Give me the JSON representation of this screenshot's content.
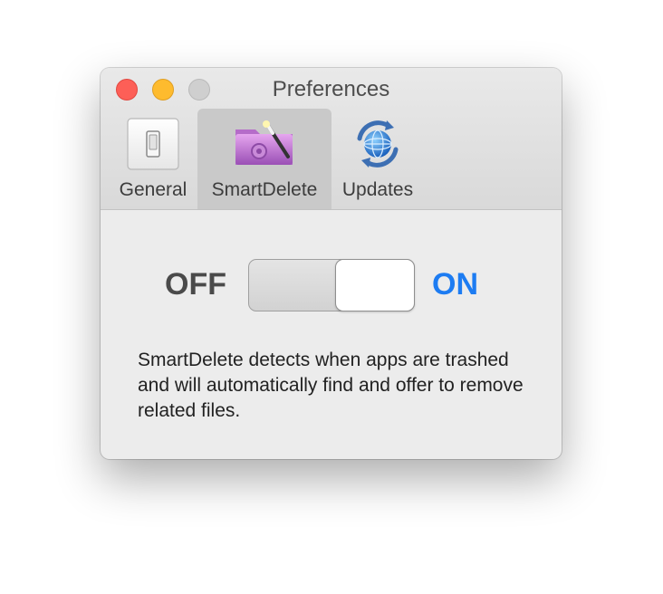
{
  "window": {
    "title": "Preferences"
  },
  "tabs": [
    {
      "label": "General",
      "icon": "light-switch-icon",
      "selected": false
    },
    {
      "label": "SmartDelete",
      "icon": "smartdelete-folder-icon",
      "selected": true
    },
    {
      "label": "Updates",
      "icon": "globe-sync-icon",
      "selected": false
    }
  ],
  "toggle": {
    "off_label": "OFF",
    "on_label": "ON",
    "state": "on"
  },
  "description": "SmartDelete detects when apps are trashed and will automatically find and offer to remove related files.",
  "colors": {
    "accent": "#1d7cf2",
    "close": "#fd5f57",
    "minimize": "#febb2e",
    "zoom_disabled": "#cfcfcf"
  }
}
